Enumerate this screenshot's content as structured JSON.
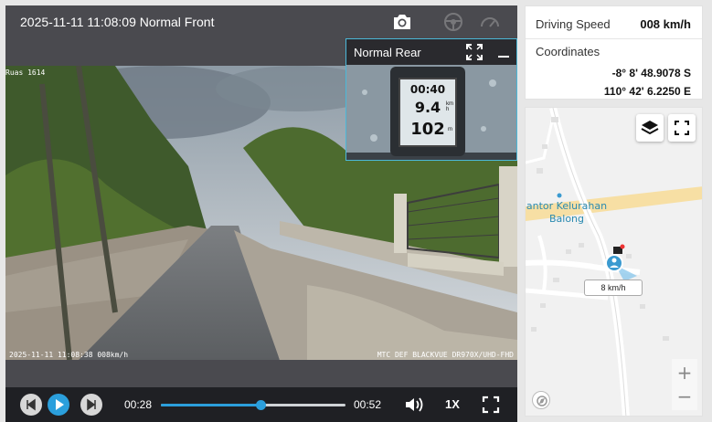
{
  "player": {
    "title": "2025-11-11 11:08:09 Normal Front",
    "osd_top_left": "Ruas 1614",
    "osd_timestamp": "2025-11-11 11:08:38 008km/h",
    "osd_device": "MTC DEF BLACKVUE DR970X/UHD-FHD"
  },
  "pip": {
    "title": "Normal Rear",
    "gps_time": "00:40",
    "gps_speed": "9.4",
    "gps_speed_unit": "km h",
    "gps_distance": "102",
    "gps_distance_unit": "m"
  },
  "controls": {
    "current_time": "00:28",
    "duration": "00:52",
    "progress_fraction": 0.54,
    "playback_speed": "1X"
  },
  "info": {
    "speed_label": "Driving Speed",
    "speed_value": "008 km/h",
    "coord_label": "Coordinates",
    "lat": "-8° 8' 48.9078 S",
    "lng": "110° 42' 6.2250 E"
  },
  "map": {
    "poi_label": "antor Kelurahan Balong",
    "speed_tag": "8 km/h",
    "zoom_in": "+",
    "zoom_out": "−"
  },
  "colors": {
    "accent": "#2b9fdc",
    "player_bg": "#4a4a4f",
    "control_bg": "#1f2024"
  }
}
